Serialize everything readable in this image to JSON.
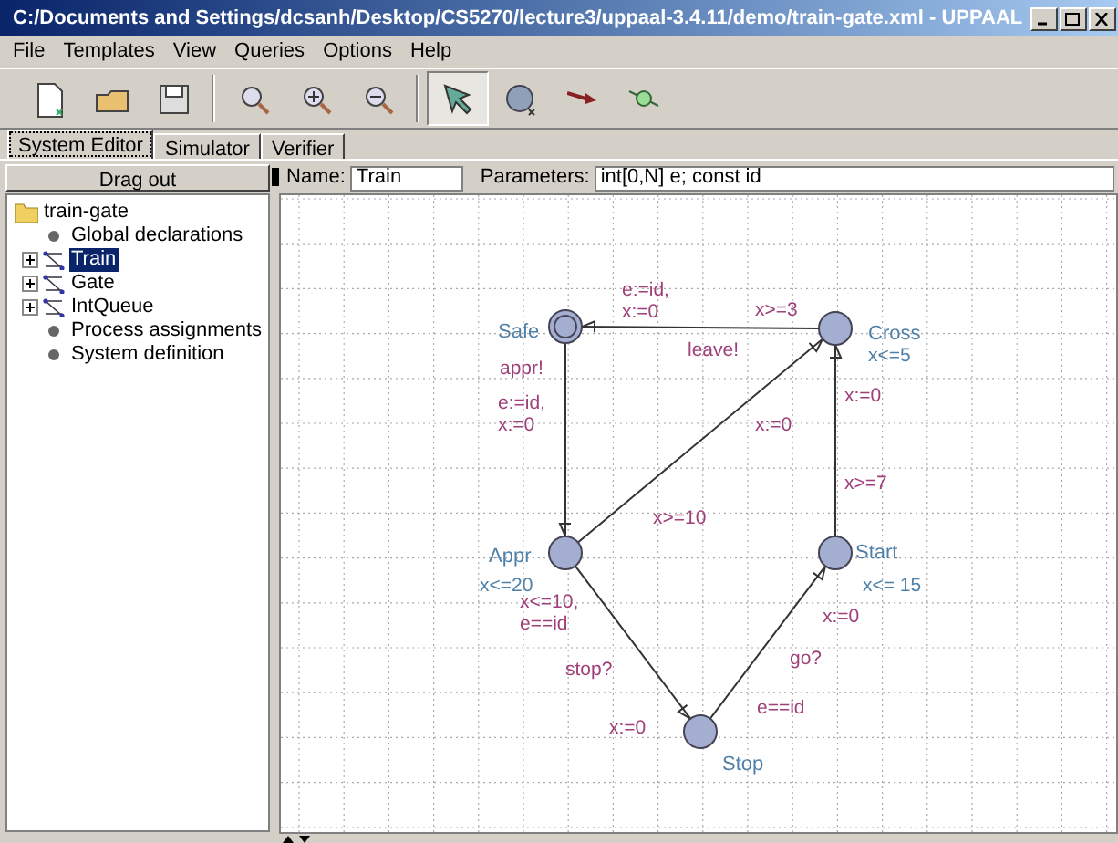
{
  "window": {
    "title": "C:/Documents and Settings/dcsanh/Desktop/CS5270/lecture3/uppaal-3.4.11/demo/train-gate.xml - UPPAAL"
  },
  "menu": [
    "File",
    "Templates",
    "View",
    "Queries",
    "Options",
    "Help"
  ],
  "toolbar": [
    {
      "kind": "new",
      "selected": false
    },
    {
      "kind": "open",
      "selected": false
    },
    {
      "kind": "save",
      "selected": false
    },
    {
      "kind": "zoom",
      "selected": false
    },
    {
      "kind": "zoom-in",
      "selected": false
    },
    {
      "kind": "zoom-out",
      "selected": false
    },
    {
      "kind": "select",
      "selected": true
    },
    {
      "kind": "location",
      "selected": false
    },
    {
      "kind": "edge",
      "selected": false
    },
    {
      "kind": "nail",
      "selected": false
    }
  ],
  "tabs": [
    {
      "label": "System Editor",
      "selected": true
    },
    {
      "label": "Simulator",
      "selected": false
    },
    {
      "label": "Verifier",
      "selected": false
    }
  ],
  "tree": {
    "header": "Drag out",
    "root": {
      "label": "train-gate",
      "children": [
        {
          "label": "Global declarations",
          "kind": "declaration",
          "selected": false
        },
        {
          "label": "Train",
          "kind": "template",
          "selected": true,
          "expanded": false
        },
        {
          "label": "Gate",
          "kind": "template",
          "selected": false,
          "expanded": false
        },
        {
          "label": "IntQueue",
          "kind": "template",
          "selected": false,
          "expanded": false
        },
        {
          "label": "Process assignments",
          "kind": "declaration",
          "selected": false
        },
        {
          "label": "System definition",
          "kind": "declaration",
          "selected": false
        }
      ]
    }
  },
  "template": {
    "name_label": "Name:",
    "name": "Train",
    "parameters_label": "Parameters:",
    "parameters": "int[0,N] e; const id"
  },
  "locations": [
    {
      "name": "Safe",
      "kind": "initial"
    },
    {
      "name": "Cross",
      "invariant": "x<=5",
      "kind": "normal"
    },
    {
      "name": "Appr",
      "invariant": "x<=20",
      "kind": "normal"
    },
    {
      "name": "Start",
      "invariant": "x<= 15",
      "kind": "normal"
    },
    {
      "name": "Stop",
      "kind": "normal"
    }
  ],
  "edges": [
    {
      "labels": [
        "e:=id,",
        "x:=0",
        "x>=3",
        "leave!"
      ]
    },
    {
      "labels": [
        "appr!",
        "e:=id,",
        "x:=0"
      ]
    },
    {
      "labels": [
        "x:=0",
        "x>=10"
      ]
    },
    {
      "labels": [
        "x:=0",
        "x>=7"
      ]
    },
    {
      "labels": [
        "x<=10,",
        "e==id",
        "stop?",
        "x:=0"
      ]
    },
    {
      "labels": [
        "go?",
        "e==id",
        "x:=0"
      ]
    }
  ]
}
